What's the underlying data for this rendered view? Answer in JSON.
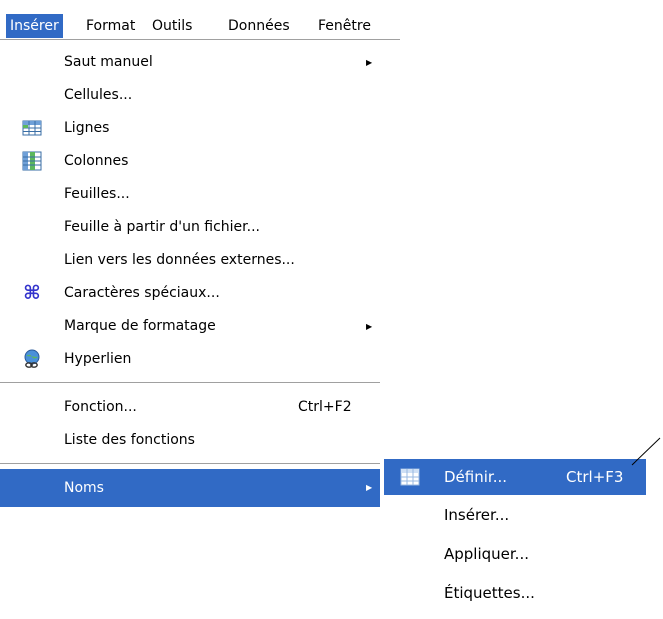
{
  "menubar": {
    "items": [
      {
        "label": "Insérer",
        "active": true
      },
      {
        "label": "Format",
        "active": false
      },
      {
        "label": "Outils",
        "active": false
      },
      {
        "label": "Données",
        "active": false
      },
      {
        "label": "Fenêtre",
        "active": false
      }
    ]
  },
  "menu": {
    "items": [
      {
        "label": "Saut manuel",
        "submenu": true
      },
      {
        "label": "Cellules..."
      },
      {
        "label": "Lignes",
        "icon": "insert-rows-icon"
      },
      {
        "label": "Colonnes",
        "icon": "insert-columns-icon"
      },
      {
        "label": "Feuilles..."
      },
      {
        "label": "Feuille à partir d'un fichier..."
      },
      {
        "label": "Lien vers les données externes..."
      },
      {
        "label": "Caractères spéciaux...",
        "icon": "special-characters-icon"
      },
      {
        "label": "Marque de formatage",
        "submenu": true
      },
      {
        "label": "Hyperlien",
        "icon": "hyperlink-icon"
      },
      {
        "label": "Fonction...",
        "shortcut": "Ctrl+F2"
      },
      {
        "label": "Liste des fonctions"
      },
      {
        "label": "Noms",
        "submenu": true,
        "highlighted": true
      }
    ]
  },
  "submenu": {
    "items": [
      {
        "label": "Définir...",
        "shortcut": "Ctrl+F3",
        "icon": "define-names-icon",
        "highlighted": true
      },
      {
        "label": "Insérer..."
      },
      {
        "label": "Appliquer..."
      },
      {
        "label": "Étiquettes..."
      }
    ]
  },
  "colors": {
    "highlight": "#316ac5",
    "separator": "#a0a0a0"
  }
}
